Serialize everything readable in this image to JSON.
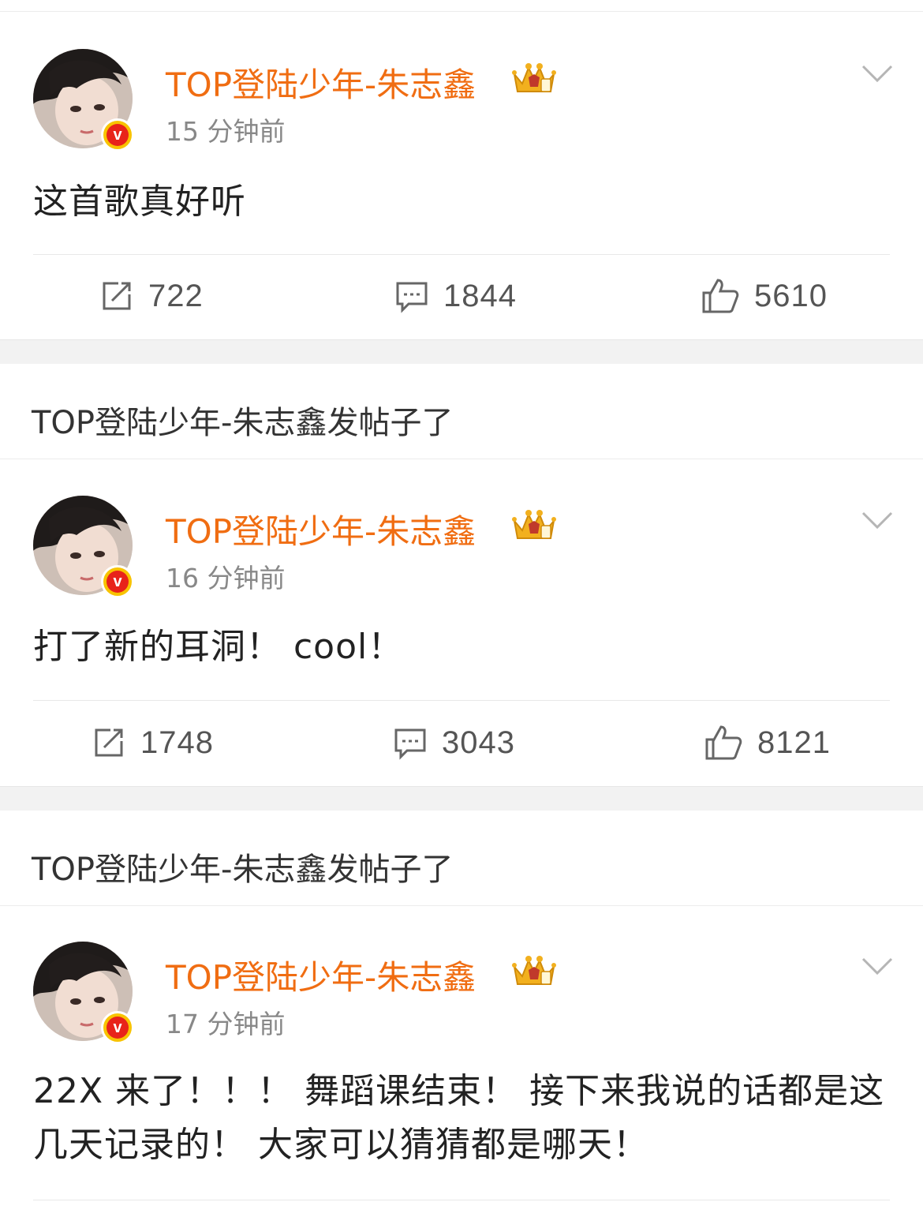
{
  "repost_notice": "TOP登陆少年-朱志鑫发帖子了",
  "posts": [
    {
      "username": "TOP登陆少年-朱志鑫",
      "time": "15 分钟前",
      "text": "这首歌真好听",
      "reposts": "722",
      "comments": "1844",
      "likes": "5610"
    },
    {
      "username": "TOP登陆少年-朱志鑫",
      "time": "16 分钟前",
      "text": "打了新的耳洞！ cool！",
      "reposts": "1748",
      "comments": "3043",
      "likes": "8121"
    },
    {
      "username": "TOP登陆少年-朱志鑫",
      "time": "17 分钟前",
      "text": "22X 来了！！！ 舞蹈课结束！ 接下来我说的话都是这几天记录的！ 大家可以猜猜都是哪天！",
      "reposts": "",
      "comments": "",
      "likes": ""
    }
  ],
  "icons": {
    "verified_badge": "verified-v-icon",
    "crown": "crown-icon",
    "chevron": "chevron-down-icon",
    "repost": "repost-icon",
    "comment": "comment-icon",
    "like": "like-icon"
  },
  "colors": {
    "username": "#f06d12",
    "badge": "#e8231a",
    "badge_ring": "#f8c300"
  }
}
